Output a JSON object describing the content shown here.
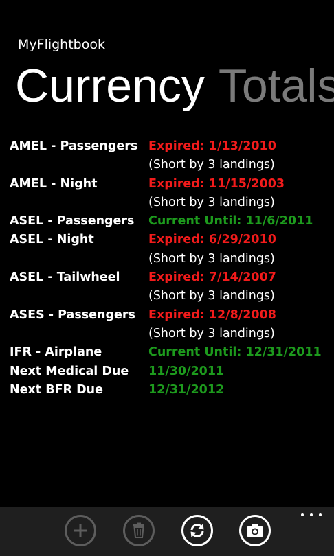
{
  "app": {
    "title": "MyFlightbook"
  },
  "pivot": {
    "items": [
      {
        "label": "Currency",
        "active": true
      },
      {
        "label": "Totals",
        "active": false
      }
    ]
  },
  "currency": {
    "rows": [
      {
        "label": "AMEL - Passengers",
        "status": "Expired: 1/13/2010",
        "state": "expired",
        "note": "(Short by 3 landings)"
      },
      {
        "label": "AMEL - Night",
        "status": "Expired: 11/15/2003",
        "state": "expired",
        "note": "(Short by 3 landings)"
      },
      {
        "label": "ASEL - Passengers",
        "status": "Current Until: 11/6/2011",
        "state": "current",
        "note": ""
      },
      {
        "label": "ASEL - Night",
        "status": "Expired: 6/29/2010",
        "state": "expired",
        "note": "(Short by 3 landings)"
      },
      {
        "label": "ASEL - Tailwheel",
        "status": "Expired: 7/14/2007",
        "state": "expired",
        "note": "(Short by 3 landings)"
      },
      {
        "label": "ASES - Passengers",
        "status": "Expired: 12/8/2008",
        "state": "expired",
        "note": "(Short by 3 landings)"
      },
      {
        "label": "IFR - Airplane",
        "status": "Current Until: 12/31/2011",
        "state": "current",
        "note": ""
      },
      {
        "label": "Next Medical Due",
        "status": "11/30/2011",
        "state": "current",
        "note": ""
      },
      {
        "label": "Next BFR Due",
        "status": "12/31/2012",
        "state": "current",
        "note": ""
      }
    ]
  },
  "colors": {
    "expired": "#f21b1b",
    "current": "#1d9a1d",
    "background": "#000000",
    "app_bar": "#1f1f1f"
  },
  "app_bar": {
    "buttons": [
      {
        "name": "add",
        "icon": "plus-icon",
        "enabled": false
      },
      {
        "name": "delete",
        "icon": "trash-icon",
        "enabled": false
      },
      {
        "name": "refresh",
        "icon": "refresh-icon",
        "enabled": true
      },
      {
        "name": "camera",
        "icon": "camera-icon",
        "enabled": true
      }
    ],
    "more_icon": "ellipsis-icon"
  }
}
